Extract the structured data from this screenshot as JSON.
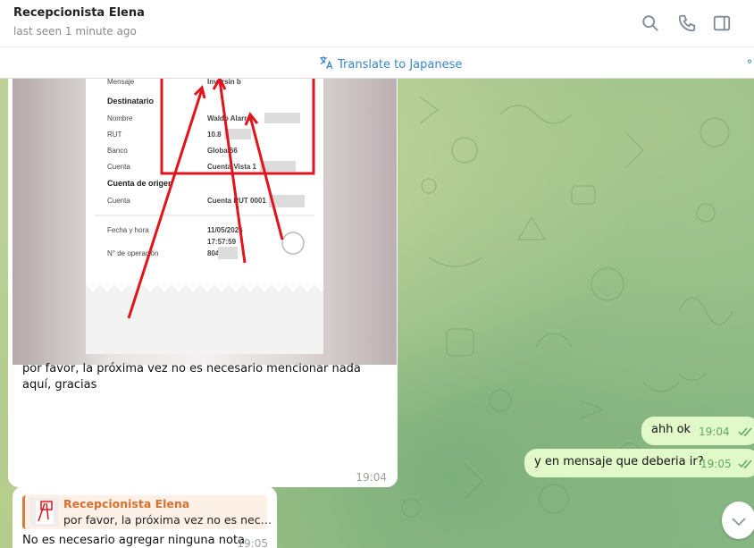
{
  "header": {
    "title": "Recepcionista Elena",
    "status": "last seen 1 minute ago",
    "icons": [
      "search-icon",
      "phone-icon",
      "sidebar-toggle-icon",
      "more-vertical-icon"
    ]
  },
  "translate_bar": {
    "label": "Translate to Japanese",
    "icon": "translate-icon"
  },
  "messages": {
    "incoming_photo": {
      "receipt": {
        "mensaje_label": "Mensaje",
        "mensaje_value": "Inversin b",
        "destinatario_label": "Destinatario",
        "nombre_label": "Nombre",
        "nombre_value": "Waldo Alarro",
        "rut_label": "RUT",
        "rut_value": "10.8",
        "banco_label": "Banco",
        "banco_value": "Global66",
        "cuenta_label": "Cuenta",
        "cuenta_value": "Cuenta Vista 1",
        "cuenta_origen_label": "Cuenta de origen",
        "cuenta2_label": "Cuenta",
        "cuenta2_value": "Cuenta RUT 0001",
        "fecha_label": "Fecha y hora",
        "fecha_value": "11/05/2026",
        "hora_value": "17:57:59",
        "operacion_label": "N° de operación",
        "operacion_value": "804"
      },
      "caption": "por favor, la próxima vez no es necesario mencionar nada aquí, gracias",
      "time": "19:04"
    },
    "outgoing_1": {
      "text": "ahh ok",
      "time": "19:04",
      "status": "read"
    },
    "outgoing_2": {
      "text": "y en mensaje que deberia ir?",
      "time": "19:05",
      "status": "read"
    },
    "incoming_reply": {
      "quote_name": "Recepcionista Elena",
      "quote_text": "por favor, la próxima vez no es nec…",
      "text": "No es necesario agregar ninguna nota",
      "time": "19:05"
    }
  },
  "colors": {
    "accent": "#3a87c8",
    "outgoing_bubble": "#e1f8c8",
    "quote_name": "#d5702e",
    "annotation_red": "#e0141c"
  }
}
